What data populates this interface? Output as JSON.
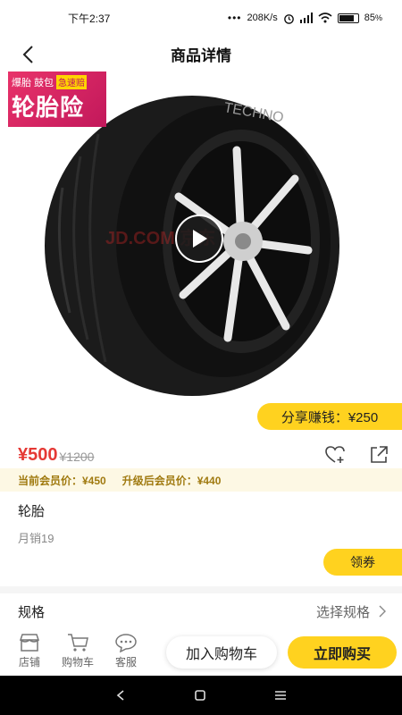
{
  "status": {
    "time": "下午2:37",
    "dots": "•••",
    "speed": "208K/s",
    "battery": "85"
  },
  "nav": {
    "title": "商品详情"
  },
  "hero": {
    "promo_small": [
      "爆胎",
      "鼓包"
    ],
    "promo_tag": "急速赔",
    "promo_main": "轮胎险",
    "watermark": "JD.COM 京东"
  },
  "share": {
    "label": "分享赚钱：¥250"
  },
  "price": {
    "current": "¥500",
    "original": "¥1200"
  },
  "member": {
    "current": "当前会员价：¥450",
    "upgrade": "升级后会员价：¥440"
  },
  "product": {
    "name": "轮胎",
    "monthly_sales": "月销19"
  },
  "coupon": {
    "label": "领券"
  },
  "spec": {
    "label": "规格",
    "select": "选择规格"
  },
  "bottom": {
    "store": "店铺",
    "cart": "购物车",
    "service": "客服",
    "add_to_cart": "加入购物车",
    "buy_now": "立即购买"
  },
  "colors": {
    "accent_yellow": "#ffd21f",
    "price_red": "#e53935",
    "member_gold": "#a07a10"
  }
}
